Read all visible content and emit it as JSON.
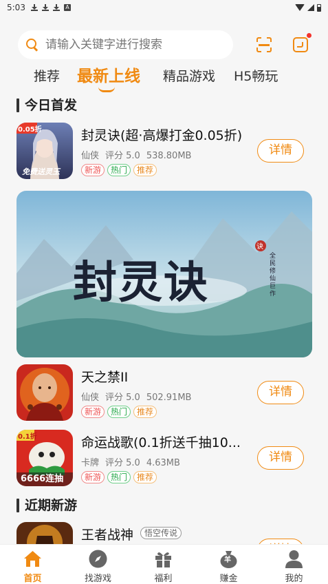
{
  "status_bar": {
    "time": "5:03",
    "a_badge": "A"
  },
  "search": {
    "placeholder": "请输入关键字进行搜索"
  },
  "colors": {
    "accent": "#f08a12",
    "badge_red": "#f3332c",
    "tag_new": "#ee5555",
    "tag_hot": "#26a84a",
    "tag_rec": "#e88a22"
  },
  "tabs": [
    {
      "label": "推荐"
    },
    {
      "label": "最新上线"
    },
    {
      "label": "精品游戏"
    },
    {
      "label": "H5畅玩"
    }
  ],
  "sections": {
    "today": "今日首发",
    "recent": "近期新游"
  },
  "games": [
    {
      "name": "封灵诀(超·高爆打金0.05折)",
      "category": "仙侠",
      "rating": "评分 5.0",
      "size": "538.80MB",
      "tags": [
        "新游",
        "热门",
        "推荐"
      ],
      "detail_label": "详情",
      "icon_badge": "0.05折",
      "icon_caption": "免费送灵玉"
    },
    {
      "name": "天之禁II",
      "category": "仙侠",
      "rating": "评分 5.0",
      "size": "502.91MB",
      "tags": [
        "新游",
        "热门",
        "推荐"
      ],
      "detail_label": "详情"
    },
    {
      "name": "命运战歌(0.1折送千抽10...",
      "category": "卡牌",
      "rating": "评分 5.0",
      "size": "4.63MB",
      "tags": [
        "新游",
        "热门",
        "推荐"
      ],
      "detail_label": "详情",
      "icon_badge": "0.1折",
      "icon_caption": "6666连抽"
    },
    {
      "name": "王者战神",
      "badge": "悟空传说",
      "detail_label": "详情"
    }
  ],
  "banner": {
    "title": "封灵诀",
    "seal": "诀",
    "subtitle": "全民修仙巨作"
  },
  "bottom_nav": [
    {
      "label": "首页",
      "icon": "home-icon"
    },
    {
      "label": "找游戏",
      "icon": "compass-icon"
    },
    {
      "label": "福利",
      "icon": "gift-icon"
    },
    {
      "label": "赚金",
      "icon": "money-bag-icon",
      "glyph": "羊"
    },
    {
      "label": "我的",
      "icon": "user-icon"
    }
  ]
}
